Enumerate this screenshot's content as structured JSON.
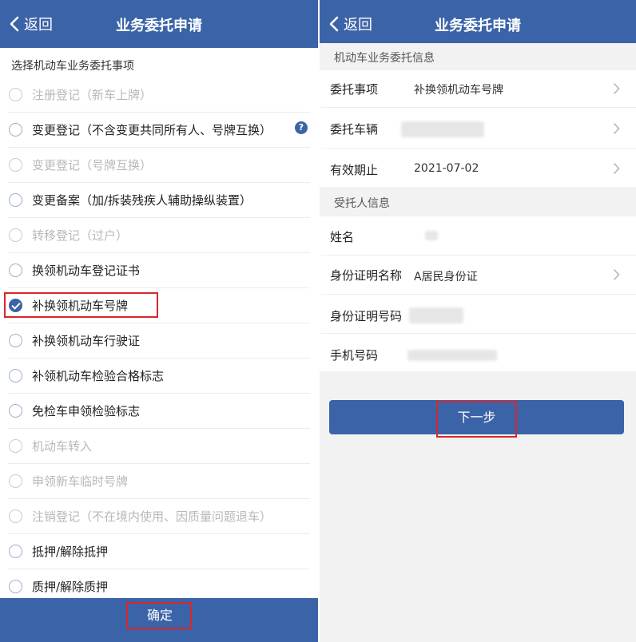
{
  "left": {
    "header": {
      "back_label": "返回",
      "title": "业务委托申请"
    },
    "section_label": "选择机动车业务委托事项",
    "options": [
      {
        "label": "注册登记（新车上牌）",
        "state": "disabled"
      },
      {
        "label": "变更登记（不含变更共同所有人、号牌互换）",
        "state": "enabled",
        "help_icon": "?"
      },
      {
        "label": "变更登记（号牌互换）",
        "state": "disabled"
      },
      {
        "label": "变更备案（加/拆装残疾人辅助操纵装置）",
        "state": "enabled"
      },
      {
        "label": "转移登记（过户）",
        "state": "disabled"
      },
      {
        "label": "换领机动车登记证书",
        "state": "enabled"
      },
      {
        "label": "补换领机动车号牌",
        "state": "selected"
      },
      {
        "label": "补换领机动车行驶证",
        "state": "enabled"
      },
      {
        "label": "补领机动车检验合格标志",
        "state": "enabled"
      },
      {
        "label": "免检车申领检验标志",
        "state": "enabled"
      },
      {
        "label": "机动车转入",
        "state": "disabled"
      },
      {
        "label": "申领新车临时号牌",
        "state": "disabled"
      },
      {
        "label": "注销登记（不在境内使用、因质量问题退车）",
        "state": "disabled"
      },
      {
        "label": "抵押/解除抵押",
        "state": "enabled"
      },
      {
        "label": "质押/解除质押",
        "state": "enabled"
      }
    ],
    "confirm_label": "确定"
  },
  "right": {
    "header": {
      "back_label": "返回",
      "title": "业务委托申请"
    },
    "section1_label": "机动车业务委托信息",
    "rows1": [
      {
        "key": "委托事项",
        "value": "补换领机动车号牌",
        "chevron": true
      },
      {
        "key": "委托车辆",
        "value": "",
        "chevron": true
      },
      {
        "key": "有效期止",
        "value": "2021-07-02",
        "chevron": true
      }
    ],
    "section2_label": "受托人信息",
    "rows2": [
      {
        "key": "姓名",
        "value": ""
      },
      {
        "key": "身份证明名称",
        "value": "A居民身份证",
        "chevron": true
      },
      {
        "key": "身份证明号码",
        "value": ""
      },
      {
        "key": "手机号码",
        "value": ""
      }
    ],
    "next_label": "下一步"
  },
  "colors": {
    "brand": "#3b64a8",
    "highlight": "#d9262c",
    "disabled_text": "#b8b8b8"
  },
  "icons": [
    "chevron-left-icon",
    "radio-icon",
    "check-icon",
    "help-icon",
    "chevron-right-icon"
  ]
}
